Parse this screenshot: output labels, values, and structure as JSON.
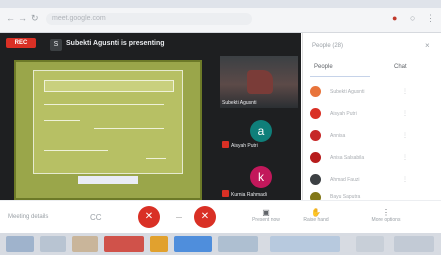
{
  "browser": {
    "url": "meet.google.com",
    "back_icon": "arrow-left-icon",
    "forward_icon": "arrow-right-icon",
    "reload_icon": "reload-icon"
  },
  "meeting": {
    "rec_label": "REC",
    "presenter_initial": "S",
    "presentation_title": "Subekti Agusnti is presenting"
  },
  "tiles": [
    {
      "name": "Subekti Agusnti"
    },
    {
      "initial": "a",
      "name": "Aisyah Putri"
    },
    {
      "initial": "k",
      "name": "Kurnia Rahmadi"
    }
  ],
  "panel": {
    "title": "People (28)",
    "close": "×",
    "tab_people": "People",
    "tab_chat": "Chat",
    "people": [
      {
        "name": "Subekti Agusnti",
        "color": "#e8743b"
      },
      {
        "name": "Aisyah Putri",
        "color": "#d93025"
      },
      {
        "name": "Annisa",
        "color": "#c62828"
      },
      {
        "name": "Anisa Salsabila",
        "color": "#b71c1c"
      },
      {
        "name": "Ahmad Fauzi",
        "color": "#3c4043"
      },
      {
        "name": "Bayu Saputra",
        "color": "#827717"
      }
    ]
  },
  "controls": {
    "meeting_details": "Meeting details",
    "cc": "CC",
    "mic": "✕",
    "cam": "✕",
    "present": "Present now",
    "raise": "Raise hand",
    "more": "More options"
  },
  "colors": {
    "danger": "#d93025",
    "meet_bg": "#1e1f21",
    "slide_green": "#9aa64a"
  }
}
